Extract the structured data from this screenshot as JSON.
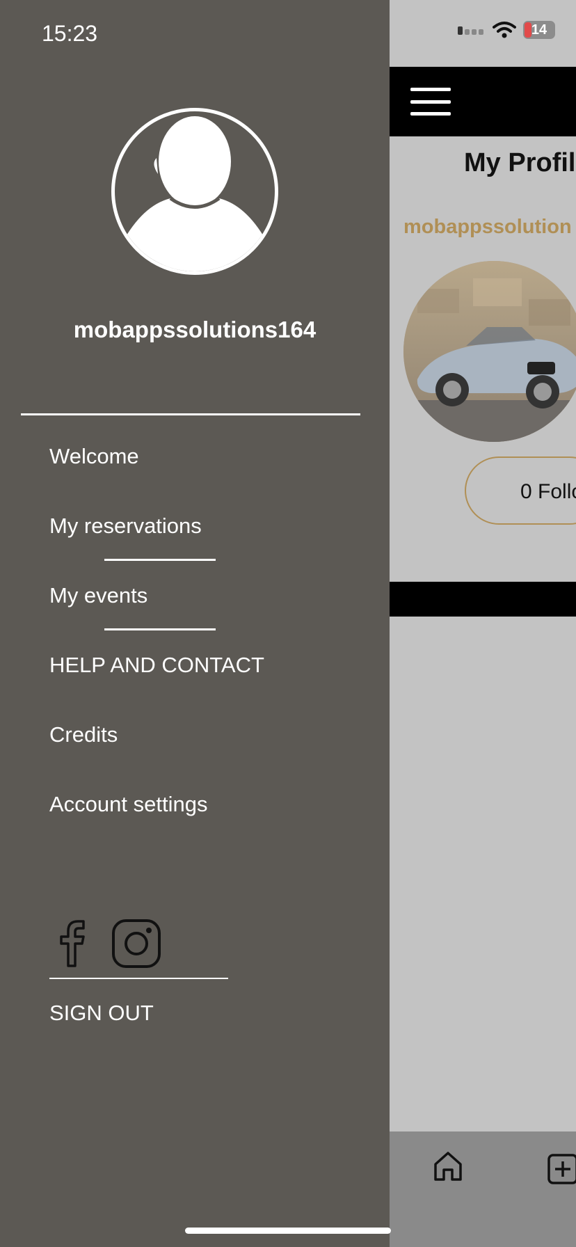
{
  "status_bar": {
    "time": "15:23",
    "battery": "14"
  },
  "drawer": {
    "username": "mobappssolutions164",
    "menu": [
      {
        "label": "Welcome"
      },
      {
        "label": "My reservations"
      },
      {
        "label": "My events"
      },
      {
        "label": "HELP AND CONTACT"
      },
      {
        "label": "Credits"
      },
      {
        "label": "Account settings"
      }
    ],
    "social": [
      "facebook-icon",
      "instagram-icon"
    ],
    "sign_out": "SIGN OUT"
  },
  "background_screen": {
    "title": "My Profil",
    "username": "mobappssolution",
    "followers": "0 Follo",
    "accent_color": "#b08f55"
  }
}
